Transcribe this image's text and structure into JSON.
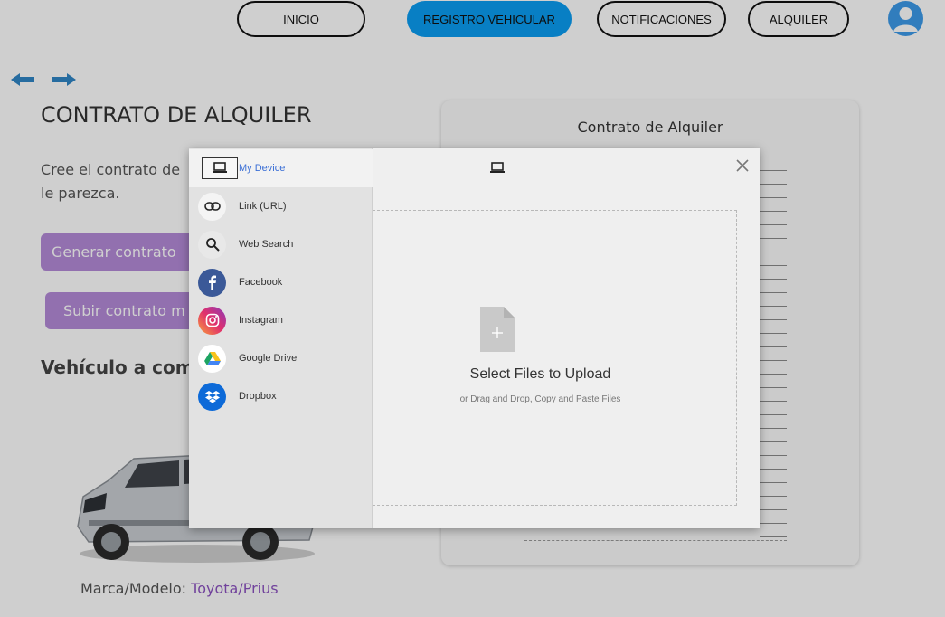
{
  "nav": {
    "inicio": "INICIO",
    "registro": "REGISTRO VEHICULAR",
    "notificaciones": "NOTIFICACIONES",
    "alquiler": "ALQUILER"
  },
  "page": {
    "title": "CONTRATO DE ALQUILER",
    "description": "Cree el contrato de le parezca.",
    "generate_button": "Generar contrato",
    "upload_button": "Subir contrato m",
    "vehicle_title": "Vehículo a comp",
    "brand_label": "Marca/Modelo:",
    "brand_value": "Toyota/Prius"
  },
  "contract_card": {
    "title": "Contrato de Alquiler"
  },
  "picker": {
    "sources": [
      {
        "label": "My Device",
        "icon": "laptop-icon"
      },
      {
        "label": "Link (URL)",
        "icon": "link-icon"
      },
      {
        "label": "Web Search",
        "icon": "search-icon"
      },
      {
        "label": "Facebook",
        "icon": "facebook-icon"
      },
      {
        "label": "Instagram",
        "icon": "instagram-icon"
      },
      {
        "label": "Google Drive",
        "icon": "google-drive-icon"
      },
      {
        "label": "Dropbox",
        "icon": "dropbox-icon"
      }
    ],
    "selected_source": "My Device",
    "select_text": "Select Files to Upload",
    "hint_text": "or Drag and Drop, Copy and Paste Files"
  },
  "colors": {
    "nav_active": "#0a9df2",
    "purple_button": "#b48ad8",
    "brand_value": "#8c52c0",
    "selected_source_text": "#3b6fd6",
    "facebook": "#3b5998",
    "dropbox": "#0d6ad8"
  }
}
